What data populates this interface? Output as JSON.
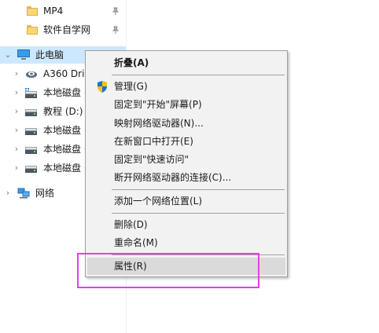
{
  "nav": {
    "pinned": [
      {
        "label": "MP4"
      },
      {
        "label": "软件自学网"
      }
    ],
    "this_pc": {
      "label": "此电脑"
    },
    "drives": [
      {
        "label": "A360 Driv"
      },
      {
        "label": "本地磁盘 ("
      },
      {
        "label": "教程 (D:)"
      },
      {
        "label": "本地磁盘 ("
      },
      {
        "label": "本地磁盘 ("
      },
      {
        "label": "本地磁盘 ("
      }
    ],
    "network": {
      "label": "网络"
    }
  },
  "context_menu": {
    "items": [
      {
        "label": "折叠(A)"
      },
      {
        "label": "管理(G)"
      },
      {
        "label": "固定到\"开始\"屏幕(P)"
      },
      {
        "label": "映射网络驱动器(N)..."
      },
      {
        "label": "在新窗口中打开(E)"
      },
      {
        "label": "固定到\"快速访问\""
      },
      {
        "label": "断开网络驱动器的连接(C)..."
      },
      {
        "label": "添加一个网络位置(L)"
      },
      {
        "label": "删除(D)"
      },
      {
        "label": "重命名(M)"
      },
      {
        "label": "属性(R)"
      }
    ]
  },
  "colors": {
    "selection": "#cce8ff",
    "annotation_box": "#e63ee6",
    "menu_background": "#f2f2f2",
    "menu_hover": "#dadada"
  }
}
